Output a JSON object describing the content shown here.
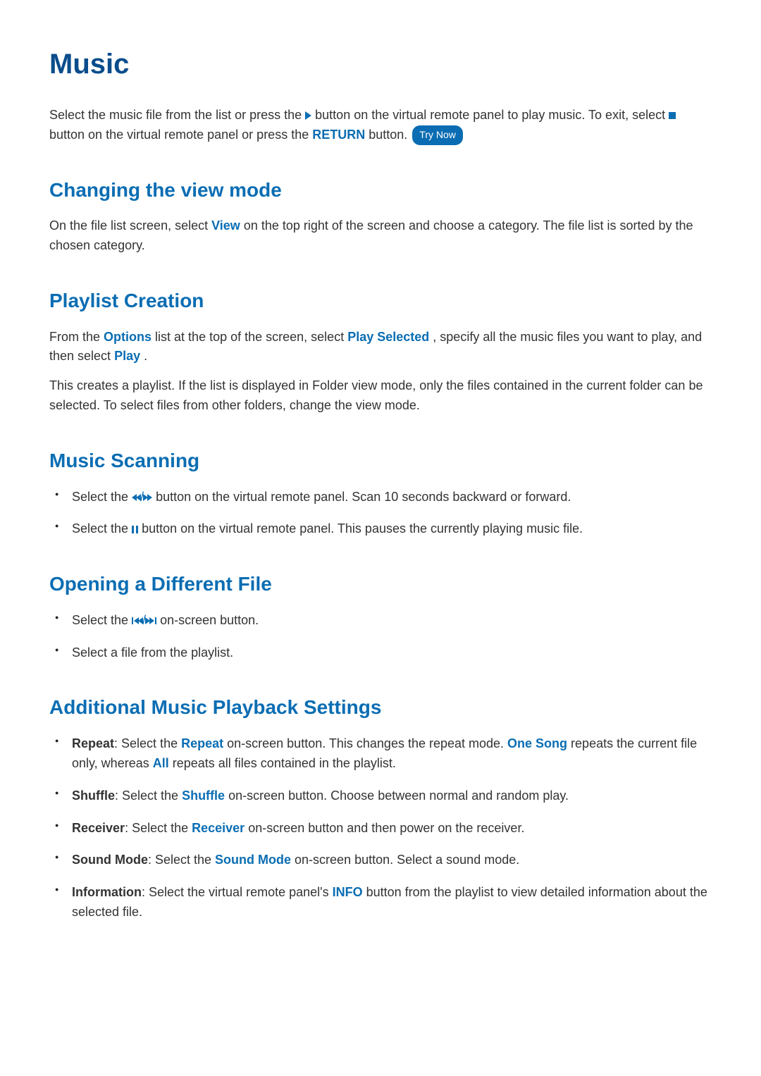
{
  "title": "Music",
  "intro": {
    "prefix": "Select the music file from the list or press the ",
    "mid1": " button on the virtual remote panel to play music. To exit, select ",
    "mid2": " button on the virtual remote panel or press the ",
    "return": "RETURN",
    "suffix": " button. ",
    "try_now": "Try Now"
  },
  "s1": {
    "heading": "Changing the view mode",
    "para_a": "On the file list screen, select ",
    "view": "View",
    "para_b": " on the top right of the screen and choose a category. The file list is sorted by the chosen category."
  },
  "s2": {
    "heading": "Playlist Creation",
    "p1_a": "From the ",
    "options": "Options",
    "p1_b": " list at the top of the screen, select ",
    "play_selected": "Play Selected",
    "p1_c": ", specify all the music files you want to play, and then select ",
    "play": "Play",
    "p1_d": ".",
    "p2": "This creates a playlist. If the list is displayed in Folder view mode, only the files contained in the current folder can be selected. To select files from other folders, change the view mode."
  },
  "s3": {
    "heading": "Music Scanning",
    "li1_a": "Select the ",
    "li1_sep": "/",
    "li1_b": " button on the virtual remote panel. Scan 10 seconds backward or forward.",
    "li2_a": "Select the ",
    "li2_b": " button on the virtual remote panel. This pauses the currently playing music file."
  },
  "s4": {
    "heading": "Opening a Different File",
    "li1_a": "Select the ",
    "li1_sep": "/",
    "li1_b": " on-screen button.",
    "li2": "Select a file from the playlist."
  },
  "s5": {
    "heading": "Additional Music Playback Settings",
    "li1_label": "Repeat",
    "li1_a": ": Select the ",
    "li1_repeat": "Repeat",
    "li1_b": " on-screen button. This changes the repeat mode. ",
    "li1_one_song": "One Song",
    "li1_c": " repeats the current file only, whereas ",
    "li1_all": "All",
    "li1_d": " repeats all files contained in the playlist.",
    "li2_label": "Shuffle",
    "li2_a": ": Select the ",
    "li2_shuffle": "Shuffle",
    "li2_b": " on-screen button. Choose between normal and random play.",
    "li3_label": "Receiver",
    "li3_a": ": Select the ",
    "li3_receiver": "Receiver",
    "li3_b": " on-screen button and then power on the receiver.",
    "li4_label": "Sound Mode",
    "li4_a": ": Select the ",
    "li4_sound_mode": "Sound Mode",
    "li4_b": " on-screen button. Select a sound mode.",
    "li5_label": "Information",
    "li5_a": ": Select the virtual remote panel's ",
    "li5_info": "INFO",
    "li5_b": " button from the playlist to view detailed information about the selected file."
  }
}
